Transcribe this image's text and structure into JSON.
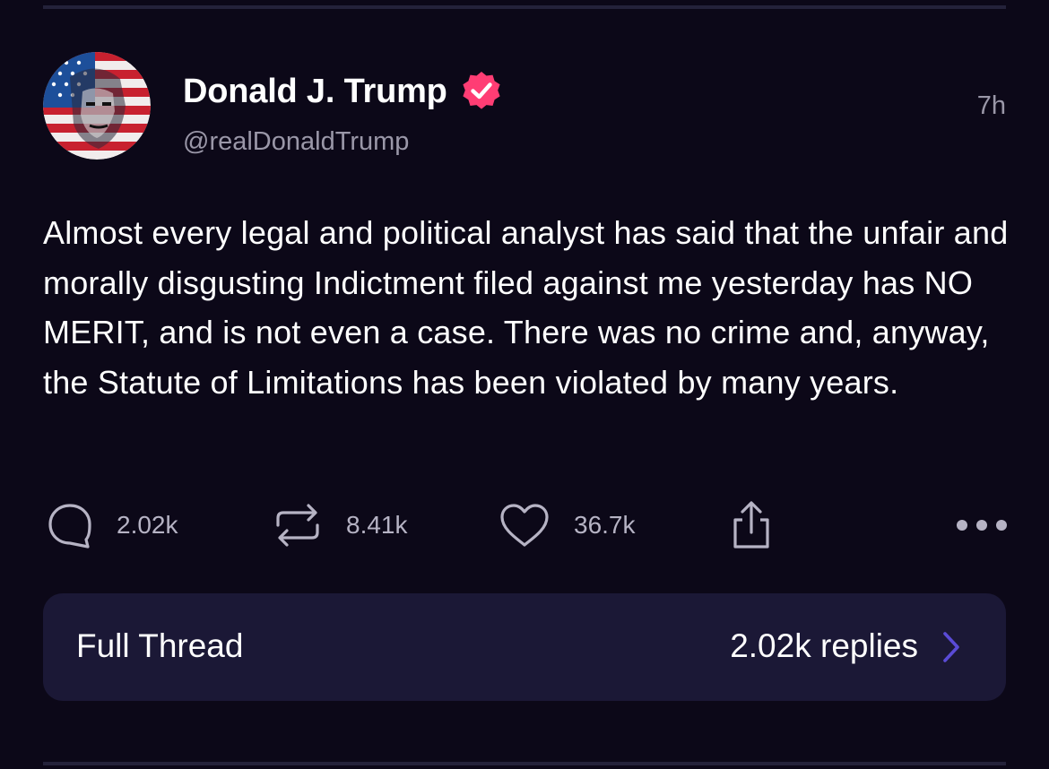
{
  "post": {
    "author": {
      "display_name": "Donald J. Trump",
      "handle": "@realDonaldTrump",
      "verified": true,
      "verified_badge_color": "#ff3d74"
    },
    "timestamp": "7h",
    "body": "Almost every legal and political analyst has said that the unfair and morally disgusting Indictment filed against me yesterday has NO MERIT, and is not even a case. There was no crime and, anyway, the Statute of Limitations has been violated by many years."
  },
  "actions": {
    "replies": {
      "icon": "reply-icon",
      "count": "2.02k"
    },
    "reposts": {
      "icon": "repost-icon",
      "count": "8.41k"
    },
    "likes": {
      "icon": "heart-icon",
      "count": "36.7k"
    },
    "share": {
      "icon": "share-icon"
    },
    "more": {
      "icon": "more-icon"
    }
  },
  "thread": {
    "label": "Full Thread",
    "replies_text": "2.02k replies",
    "chevron_icon": "chevron-right-icon",
    "chevron_color": "#5a4bd6"
  },
  "theme": {
    "background": "#0c0818",
    "card_background": "#1b1836",
    "text_primary": "#ffffff",
    "text_secondary": "#9a97a8"
  }
}
